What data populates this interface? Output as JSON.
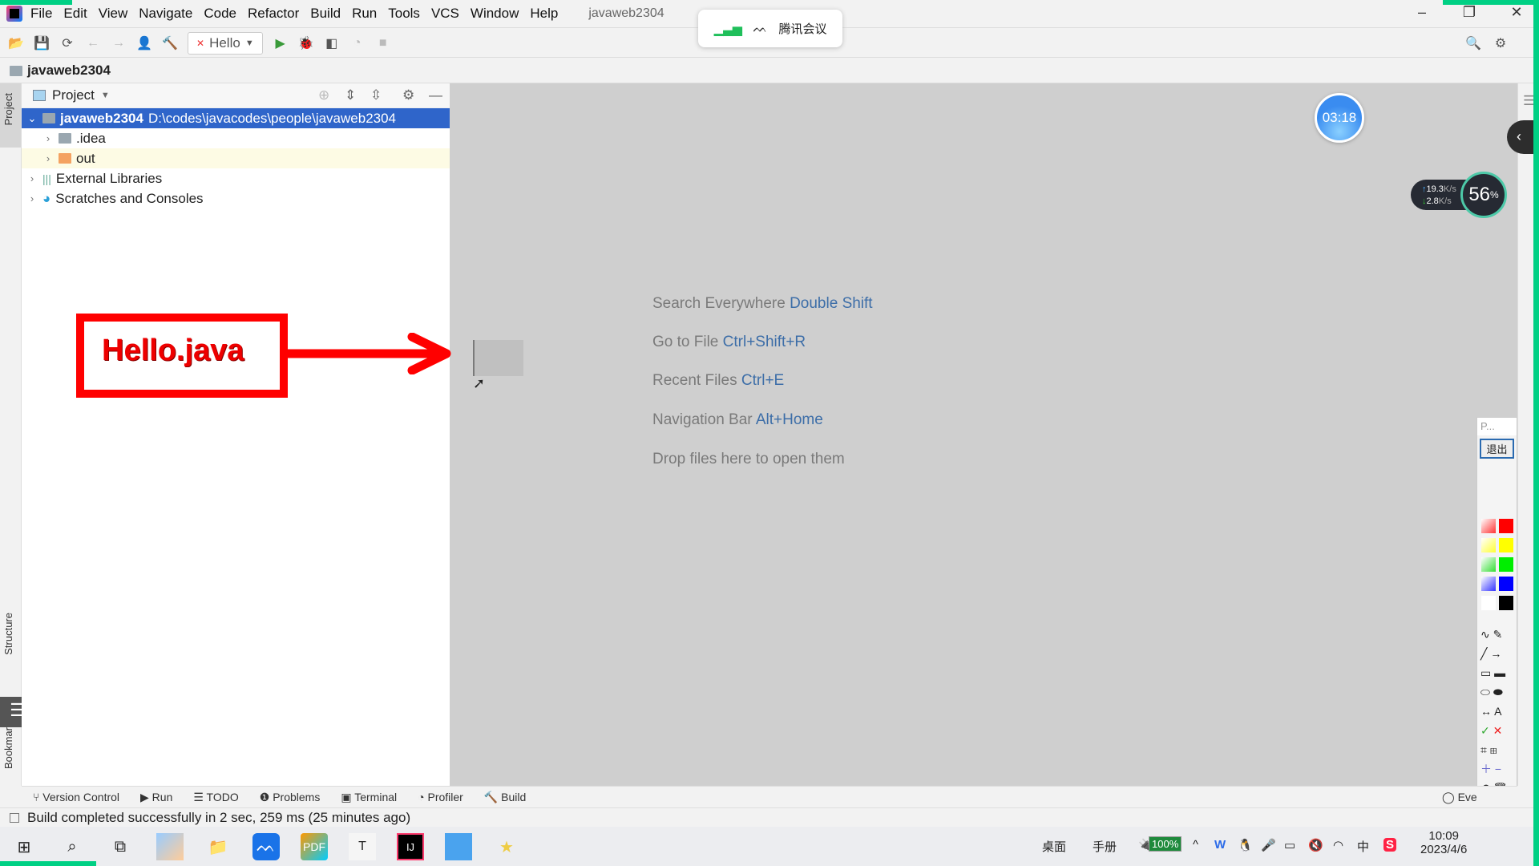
{
  "app": {
    "window_title": "javaweb2304"
  },
  "menu": [
    "File",
    "Edit",
    "View",
    "Navigate",
    "Code",
    "Refactor",
    "Build",
    "Run",
    "Tools",
    "VCS",
    "Window",
    "Help"
  ],
  "toolbar": {
    "run_config": "Hello"
  },
  "navbar": {
    "project": "javaweb2304"
  },
  "project_panel": {
    "title": "Project",
    "tree": [
      {
        "name": "javaweb2304",
        "path": "D:\\codes\\javacodes\\people\\javaweb2304",
        "expanded": true,
        "selected": true
      },
      {
        "name": ".idea"
      },
      {
        "name": "out"
      },
      {
        "name": "External Libraries"
      },
      {
        "name": "Scratches and Consoles"
      }
    ]
  },
  "left_stripe": {
    "project": "Project",
    "structure": "Structure",
    "bookmarks": "Bookmarks"
  },
  "editor_hints": [
    {
      "label": "Search Everywhere",
      "key": "Double Shift"
    },
    {
      "label": "Go to File",
      "key": "Ctrl+Shift+R"
    },
    {
      "label": "Recent Files",
      "key": "Ctrl+E"
    },
    {
      "label": "Navigation Bar",
      "key": "Alt+Home"
    },
    {
      "label": "Drop files here to open them",
      "key": ""
    }
  ],
  "annotation": {
    "callout": "Hello.java",
    "color": "#ff0000"
  },
  "tool_windows": [
    "Version Control",
    "Run",
    "TODO",
    "Problems",
    "Terminal",
    "Profiler",
    "Build"
  ],
  "event_log": "Eve",
  "status": "Build completed successfully in 2 sec, 259 ms (25 minutes ago)",
  "meeting": {
    "label": "腾讯会议"
  },
  "timer": "03:18",
  "network": {
    "up": "19.3",
    "down": "2.8",
    "unit": "K/s",
    "cpu": "56",
    "cpu_unit": "%"
  },
  "pen_toolbar": {
    "title": "P...",
    "exit": "退出"
  },
  "taskbar": {
    "desktop": "桌面",
    "manual": "手册",
    "battery": "100%",
    "ime": "中",
    "time": "10:09",
    "date": "2023/4/6"
  }
}
